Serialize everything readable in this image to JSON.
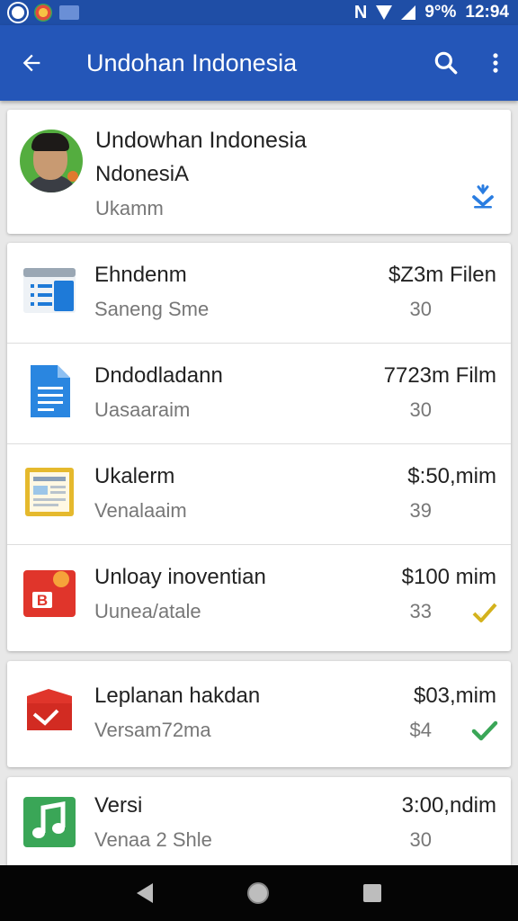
{
  "status_bar": {
    "battery": "9°%",
    "time": "12:94"
  },
  "app_bar": {
    "title": "Undohan Indonesia"
  },
  "header": {
    "name": "Undowhan Indonesia",
    "subtitle": "NdonesiA",
    "meta": "Ukamm"
  },
  "items": [
    {
      "title": "Ehndenm",
      "subtitle": "Saneng Sme",
      "price": "$Z3m Filen",
      "count": "30",
      "icon": "list-icon",
      "status_icon": ""
    },
    {
      "title": "Dndodladann",
      "subtitle": "Uasaaraim",
      "price": "7723m Film",
      "count": "30",
      "icon": "document-icon",
      "status_icon": ""
    },
    {
      "title": "Ukalerm",
      "subtitle": "Venalaaim",
      "price": "$:50,mim",
      "count": "39",
      "icon": "form-icon",
      "status_icon": ""
    },
    {
      "title": "Unloay inoventian",
      "subtitle": "Uunea/atale",
      "price": "$100 mim",
      "count": "33",
      "icon": "badge-b-icon",
      "status_icon": "check-outline-icon"
    }
  ],
  "card5": {
    "title": "Leplanan hakdan",
    "subtitle": "Versam72ma",
    "price": "$03,mim",
    "count": "$4",
    "icon": "mail-icon",
    "status_icon": "check-icon"
  },
  "card6": {
    "title": "Versi",
    "subtitle": "Venaa 2 Shle",
    "price": "3:00,ndim",
    "count": "30",
    "icon": "music-icon"
  },
  "colors": {
    "app_bar": "#2456b8",
    "status_bar": "#1f4ea6",
    "download_accent": "#2a7de1",
    "check_green": "#3aa657",
    "check_yellow": "#d4b21c"
  }
}
